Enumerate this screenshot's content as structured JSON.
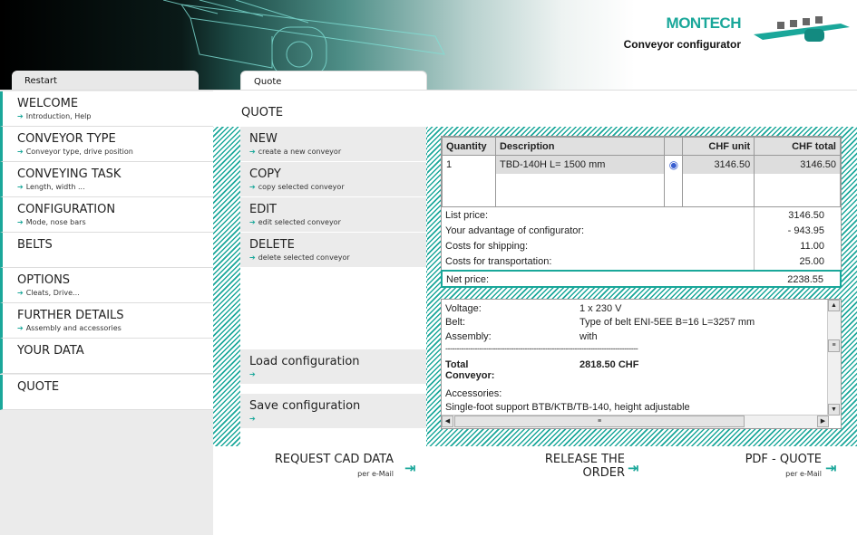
{
  "header": {
    "logo": "MONTECH",
    "subtitle": "Conveyor configurator"
  },
  "tabs": {
    "restart": "Restart",
    "quote": "Quote"
  },
  "nav": [
    {
      "title": "WELCOME",
      "sub": "Introduction, Help"
    },
    {
      "title": "CONVEYOR TYPE",
      "sub": "Conveyor type, drive position"
    },
    {
      "title": "CONVEYING TASK",
      "sub": "Length, width ..."
    },
    {
      "title": "CONFIGURATION",
      "sub": "Mode, nose bars"
    },
    {
      "title": "BELTS",
      "sub": ""
    },
    {
      "title": "OPTIONS",
      "sub": "Cleats, Drive..."
    },
    {
      "title": "FURTHER DETAILS",
      "sub": "Assembly and accessories"
    },
    {
      "title": "YOUR DATA",
      "sub": ""
    },
    {
      "title": "QUOTE",
      "sub": ""
    }
  ],
  "quote_heading": "QUOTE",
  "actions": [
    {
      "title": "NEW",
      "sub": "create a new conveyor"
    },
    {
      "title": "COPY",
      "sub": "copy selected conveyor"
    },
    {
      "title": "EDIT",
      "sub": "edit selected conveyor"
    },
    {
      "title": "DELETE",
      "sub": "delete selected conveyor"
    }
  ],
  "load_config": "Load configuration",
  "save_config": "Save configuration",
  "table": {
    "headers": {
      "qty": "Quantity",
      "desc": "Description",
      "unit": "CHF unit",
      "total": "CHF total"
    },
    "rows": [
      {
        "qty": "1",
        "desc": "TBD-140H L= 1500 mm",
        "unit": "3146.50",
        "total": "3146.50"
      }
    ]
  },
  "prices": {
    "list_label": "List price:",
    "list_value": "3146.50",
    "advantage_label": "Your advantage of configurator:",
    "advantage_value": "- 943.95",
    "shipping_label": "Costs for shipping:",
    "shipping_value": "11.00",
    "transport_label": "Costs for transportation:",
    "transport_value": "25.00",
    "net_label": "Net price:",
    "net_value": "2238.55"
  },
  "details": {
    "voltage_label": "Voltage:",
    "voltage_value": "1 x 230 V",
    "belt_label": "Belt:",
    "belt_value": "Type of belt ENI-5EE B=16 L=3257 mm",
    "assembly_label": "Assembly:",
    "assembly_value": "with",
    "separator": "-------------------------------------------------------------------------------------",
    "total_label": "Total Conveyor:",
    "total_value": "2818.50 CHF",
    "accessories_label": "Accessories:",
    "accessory_item": "Single-foot support BTB/KTB/TB-140, height adjustable"
  },
  "bottom": {
    "cad_label": "REQUEST CAD DATA",
    "cad_sub": "per e-Mail",
    "release_label": "RELEASE THE ORDER",
    "pdf_label": "PDF - QUOTE",
    "pdf_sub": "per e-Mail"
  },
  "colors": {
    "accent": "#1aa79a"
  }
}
